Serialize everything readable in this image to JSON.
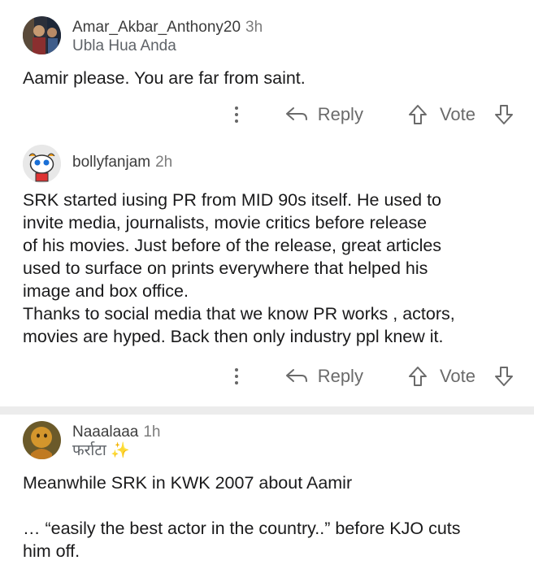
{
  "comments": [
    {
      "username": "Amar_Akbar_Anthony20",
      "time": "3h",
      "flair": "Ubla Hua Anda",
      "body": "Aamir please. You are far from saint.",
      "reply_label": "Reply",
      "vote_label": "Vote"
    },
    {
      "username": "bollyfanjam",
      "time": "2h",
      "flair": "",
      "body": "SRK started iusing PR from MID 90s itself. He used to\ninvite media, journalists, movie critics before release\nof his movies. Just before of the release, great articles\nused to surface on prints everywhere that helped his\nimage and box office.\nThanks to social media that we know PR works , actors,\nmovies are hyped. Back then only industry ppl knew it.",
      "reply_label": "Reply",
      "vote_label": "Vote"
    },
    {
      "username": "Naaalaaa",
      "time": "1h",
      "flair": "फर्राटा ✨",
      "body": "Meanwhile SRK in KWK 2007 about Aamir\n\n… “easily the best actor in the country..” before KJO cuts\nhim off."
    }
  ],
  "colors": {
    "divider": "#ececec",
    "action_gray": "#6a6a6a"
  },
  "icons": [
    "more-options-icon",
    "reply-arrow-icon",
    "upvote-arrow-icon",
    "downvote-arrow-icon"
  ]
}
